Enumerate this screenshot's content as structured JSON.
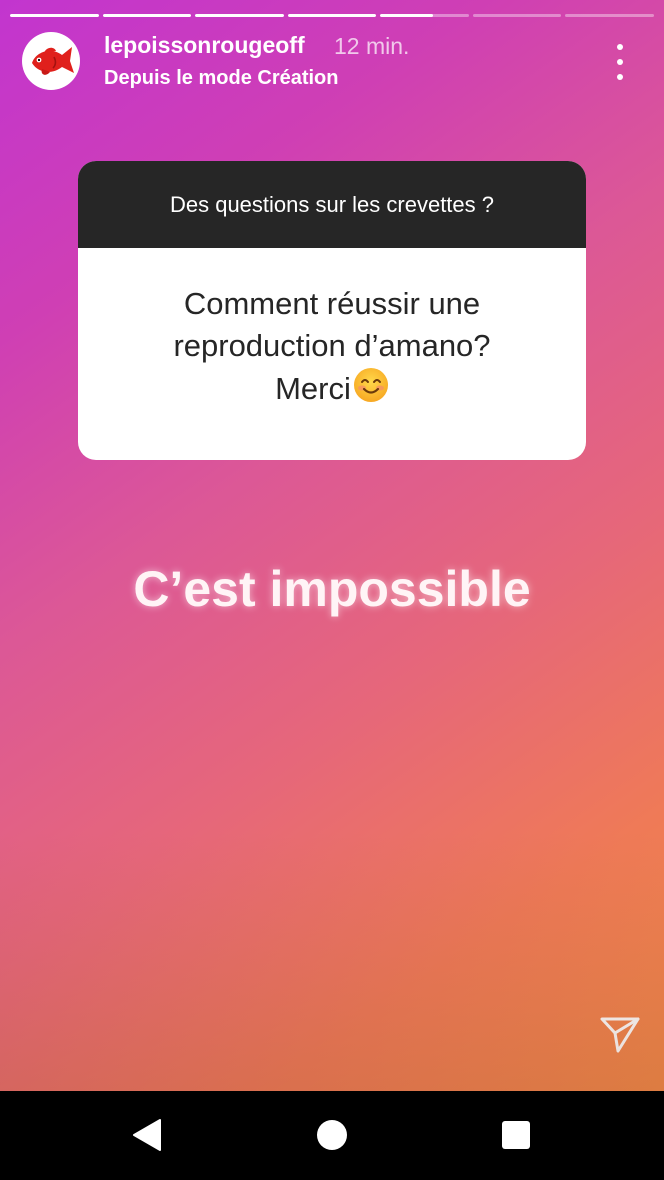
{
  "story": {
    "progress": [
      1,
      1,
      1,
      1,
      0.6,
      0,
      0
    ],
    "author": {
      "username": "lepoissonrougeoff",
      "time": "12 min.",
      "subtitle": "Depuis le mode Création",
      "avatar_icon": "red-fish-logo-icon"
    },
    "question_sticker": {
      "prompt": "Des questions sur les crevettes ?",
      "response_lines": [
        "Comment réussir une",
        "reproduction d’amano?",
        "Merci"
      ],
      "response_emoji": "smiling-face-icon"
    },
    "answer_text": "C’est impossible",
    "more_icon": "more-vertical-icon",
    "share_icon": "send-icon"
  },
  "nav": {
    "back_icon": "back-triangle-icon",
    "home_icon": "home-circle-icon",
    "recents_icon": "recents-square-icon"
  },
  "colors": {
    "gradient_start": "#c235cf",
    "gradient_end": "#f38a47",
    "card_header": "#262626",
    "card_body": "#ffffff"
  }
}
